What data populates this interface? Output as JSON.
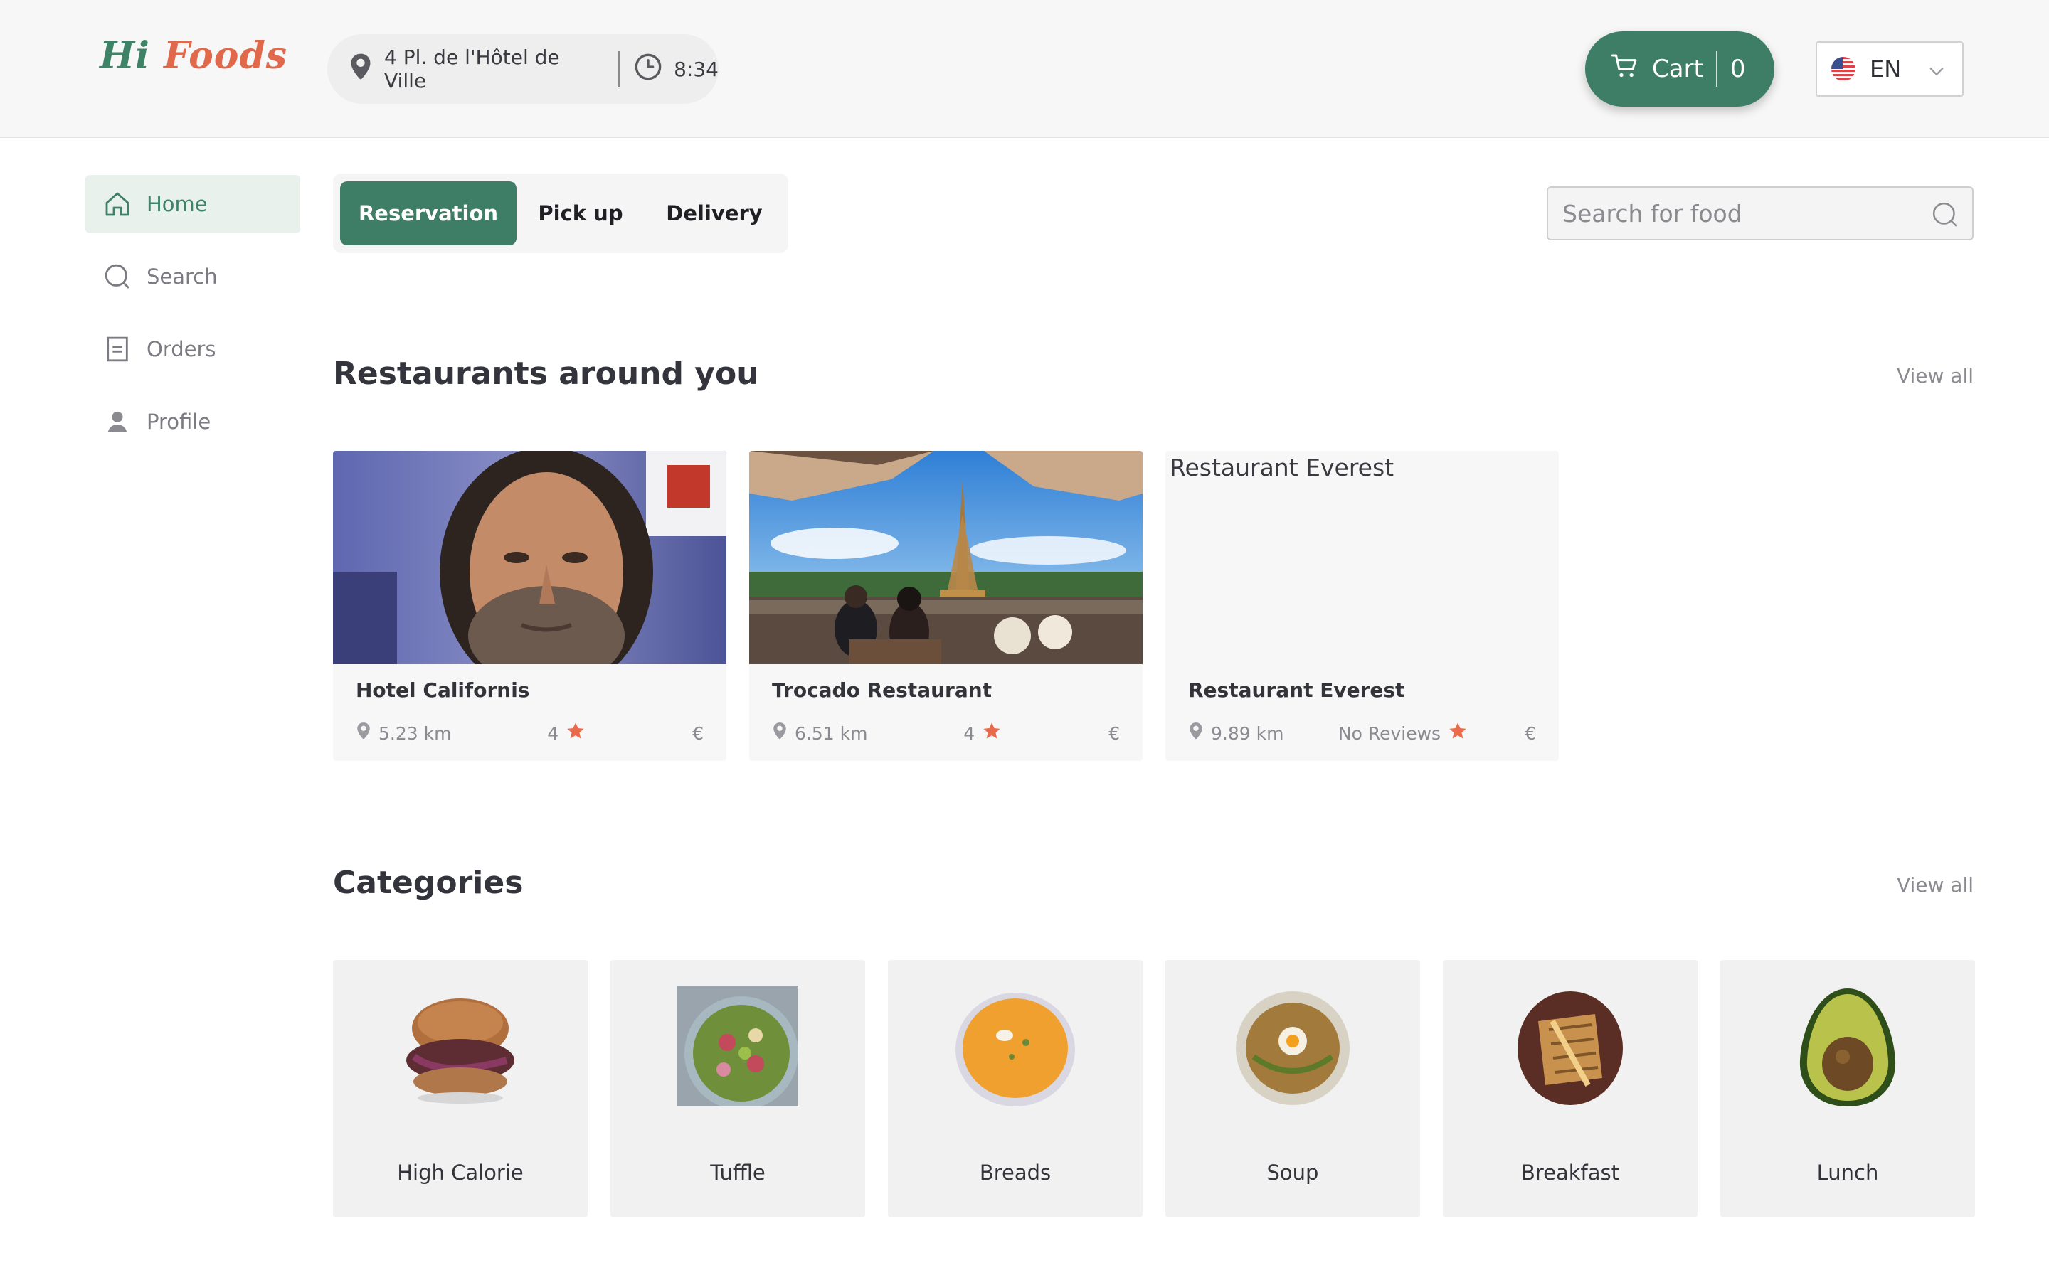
{
  "logo": {
    "hi": "Hi",
    "foods": "Foods"
  },
  "location": {
    "address": "4 Pl. de l'Hôtel de Ville",
    "time": "8:34"
  },
  "cart": {
    "label": "Cart",
    "count": "0"
  },
  "language": {
    "code": "EN",
    "flag": "us-flag-icon"
  },
  "sidebar": {
    "items": [
      {
        "label": "Home",
        "icon": "home-icon",
        "active": true
      },
      {
        "label": "Search",
        "icon": "search-icon",
        "active": false
      },
      {
        "label": "Orders",
        "icon": "orders-icon",
        "active": false
      },
      {
        "label": "Profile",
        "icon": "profile-icon",
        "active": false
      }
    ]
  },
  "modes": {
    "reservation": "Reservation",
    "pickup": "Pick up",
    "delivery": "Delivery",
    "selected": "Reservation"
  },
  "search": {
    "placeholder": "Search for food"
  },
  "restaurants_section": {
    "title": "Restaurants around you",
    "view_all": "View all",
    "items": [
      {
        "name": "Hotel Californis",
        "distance": "5.23 km",
        "rating": "4",
        "price": "€"
      },
      {
        "name": "Trocado Restaurant",
        "distance": "6.51 km",
        "rating": "4",
        "price": "€"
      },
      {
        "name": "Restaurant Everest",
        "image_alt": "Restaurant Everest",
        "distance": "9.89 km",
        "rating": "No Reviews",
        "price": "€"
      }
    ]
  },
  "categories_section": {
    "title": "Categories",
    "view_all": "View all",
    "items": [
      {
        "name": "High Calorie"
      },
      {
        "name": "Tuffle"
      },
      {
        "name": "Breads"
      },
      {
        "name": "Soup"
      },
      {
        "name": "Breakfast"
      },
      {
        "name": "Lunch"
      }
    ]
  },
  "colors": {
    "brand_green": "#3e7e66",
    "brand_orange": "#e0694b",
    "star": "#ea6a4c"
  }
}
